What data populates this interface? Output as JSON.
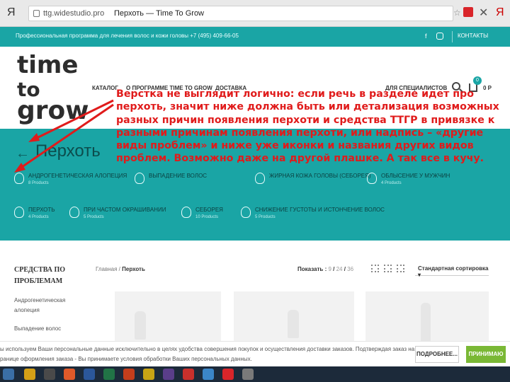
{
  "browser": {
    "ya_left": "Я",
    "url": "ttg.widestudio.pro",
    "title": "Перхоть — Time To Grow",
    "ya_right": "Я"
  },
  "topbar": {
    "promo": "Профессиональная программа для лечения волос и кожи головы +7 (495) 409-66-05",
    "fb": "f",
    "contacts": "КОНТАКТЫ"
  },
  "logo": {
    "line1": "time",
    "line2": "to",
    "line3": "grow"
  },
  "nav": {
    "catalog": "КАТАЛОГ",
    "program": "О ПРОГРАММЕ TIME TO GROW",
    "delivery": "ДОСТАВКА",
    "specialists": "ДЛЯ СПЕЦИАЛИСТОВ",
    "cart_count": "0",
    "cart_sum": "0 Р"
  },
  "hero": {
    "back": "←",
    "title": "Перхоть",
    "categories": [
      {
        "name": "АНДРОГЕНЕТИЧЕСКАЯ АЛОПЕЦИЯ",
        "count": "8 Products"
      },
      {
        "name": "ВЫПАДЕНИЕ ВОЛОС",
        "count": ""
      },
      {
        "name": "ЖИРНАЯ КОЖА ГОЛОВЫ (СЕБОРЕЯ)",
        "count": ""
      },
      {
        "name": "ОБЛЫСЕНИЕ У МУЖЧИН",
        "count": "4 Products"
      },
      {
        "name": "ПЕРХОТЬ",
        "count": "4 Products"
      },
      {
        "name": "ПРИ ЧАСТОМ ОКРАШИВАНИИ",
        "count": "5 Products"
      },
      {
        "name": "СЕБОРЕЯ",
        "count": "10 Products"
      },
      {
        "name": "СНИЖЕНИЕ ГУСТОТЫ И ИСТОНЧЕНИЕ ВОЛОС",
        "count": "5 Products"
      }
    ]
  },
  "sidebar": {
    "title": "СРЕДСТВА ПО ПРОБЛЕМАМ",
    "items": [
      "Андрогенетическая алопеция",
      "Выпадение волос"
    ]
  },
  "toolbar": {
    "breadcrumb_home": "Главная",
    "breadcrumb_sep": " / ",
    "breadcrumb_current": "Перхоть",
    "show_label": "Показать :",
    "show_9": "9",
    "show_24": "24",
    "show_36": "36",
    "sort": "Стандартная сортировка"
  },
  "cookie": {
    "line1": "ы используем Ваши персональные данные исключительно в целях удобства совершения покупок и осуществления доставки заказов. Подтверждая заказ на",
    "line2": "ранице оформления заказа - Вы принимаете условия обработки Ваших персональных данных.",
    "more": "ПОДРОБНЕЕ...",
    "accept": "ПРИНИМАЮ"
  },
  "annotation": {
    "text": "Верстка не выглядит логично: если речь в разделе идет про перхоть, значит ниже должна быть или детализация возможных разных причин появления перхоти и средства ТТГР в привязке к разными причинам появления перхоти, или надпись – «другие виды проблем» и ниже уже иконки и названия других видов проблем. Возможно даже на другой плашке. А так все в кучу."
  },
  "colors": {
    "teal": "#1aa5a5",
    "annotation_red": "#e01b1b",
    "accept_green": "#7ab835"
  }
}
